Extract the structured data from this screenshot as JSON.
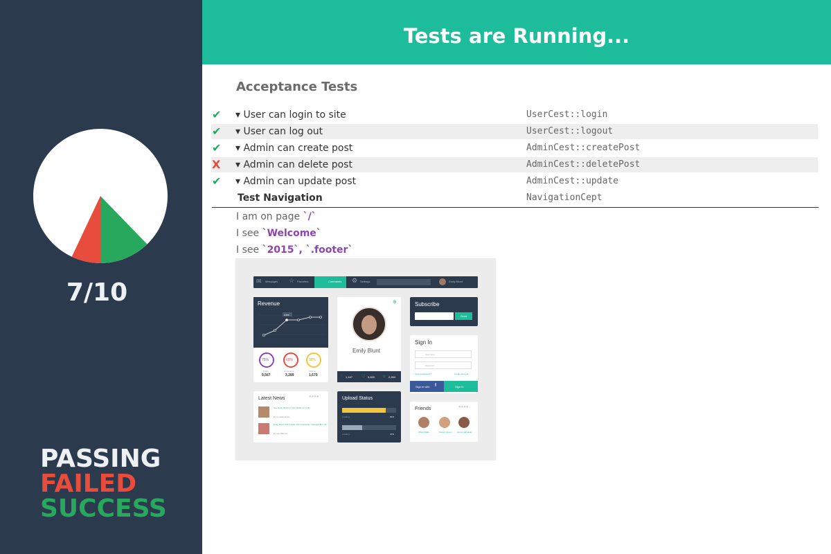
{
  "header": {
    "title": "Tests are Running..."
  },
  "summary": {
    "score": "7/10",
    "progress": {
      "passed": 7,
      "total": 10
    },
    "legend": [
      {
        "label": "PASSING",
        "color": "#eef1f4"
      },
      {
        "label": "FAILED",
        "color": "#e74c3c"
      },
      {
        "label": "SUCCESS",
        "color": "#27a85c"
      }
    ]
  },
  "colors": {
    "accent": "#1dbc9b",
    "sidebar": "#2c3a4d",
    "pass": "#27a85c",
    "fail": "#e74c3c",
    "code": "#8e44ad"
  },
  "suite": {
    "title": "Acceptance Tests",
    "tests": [
      {
        "status": "✔",
        "state": "pass",
        "name": "▾ User can login to site",
        "ref": "UserCest::login"
      },
      {
        "status": "✔",
        "state": "pass",
        "name": "▾ User can log out",
        "ref": "UserCest::logout"
      },
      {
        "status": "✔",
        "state": "pass",
        "name": "▾ Admin can create post",
        "ref": "AdminCest::createPost"
      },
      {
        "status": "X",
        "state": "fail",
        "name": "▾ Admin can delete post",
        "ref": "AdminCest::deletePost"
      },
      {
        "status": "✔",
        "state": "pass",
        "name": "▾ Admin can update post",
        "ref": "AdminCest::update"
      }
    ],
    "current": {
      "name": "Test Navigation",
      "ref": "NavigationCept"
    },
    "steps": [
      {
        "text": "I am on page ",
        "code": "`/`"
      },
      {
        "text": "I see ",
        "code": "`Welcome`"
      },
      {
        "text": "I see ",
        "code": "`2015`, `.footer`"
      }
    ]
  },
  "screenshot": {
    "nav": [
      "Messages",
      "Favorites",
      "Comments",
      "Settings",
      "Emily Blunt"
    ],
    "revenue": {
      "title": "Revenue",
      "tooltip": "6,556",
      "stats": [
        {
          "percent": "75%",
          "label": "Posts",
          "value": "9,567"
        },
        {
          "percent": "60%",
          "label": "Comments",
          "value": "3,289"
        },
        {
          "percent": "38%",
          "label": "Sharing",
          "value": "1,670"
        }
      ]
    },
    "profile": {
      "name": "Emily Blunt",
      "counts": [
        "1,147",
        "3,820",
        "2,994"
      ]
    },
    "subscribe": {
      "title": "Subscribe",
      "button": "Send"
    },
    "signin": {
      "title": "Sign In",
      "username": "Username",
      "password": "Password",
      "forgot": "Forgot password?",
      "create": "Create account",
      "facebook": "Sign in with",
      "submit": "Sign In"
    },
    "news": {
      "title": "Latest News",
      "items": [
        {
          "title": "See Emily Blunt's 7 Hot Outfits in 1 GIF!",
          "by": "by Cornelia Rossi"
        },
        {
          "title": "Emily Blunt Tells Initiate John Krasinski \"Changed My Life\"",
          "by": "by Ivan Barinov"
        }
      ]
    },
    "upload": {
      "title": "Upload Status",
      "bars": [
        {
          "label": "Loading...",
          "value": "81%",
          "fraction": 0.81,
          "color": "#f3c53d"
        },
        {
          "label": "Loading...",
          "value": "37%",
          "fraction": 0.37,
          "color": "#9aaabb"
        }
      ]
    },
    "friends": {
      "title": "Friends",
      "people": [
        {
          "name": "Olivia Wilde"
        },
        {
          "name": "Steven Green"
        },
        {
          "name": "Annie Hathaway"
        }
      ]
    }
  }
}
